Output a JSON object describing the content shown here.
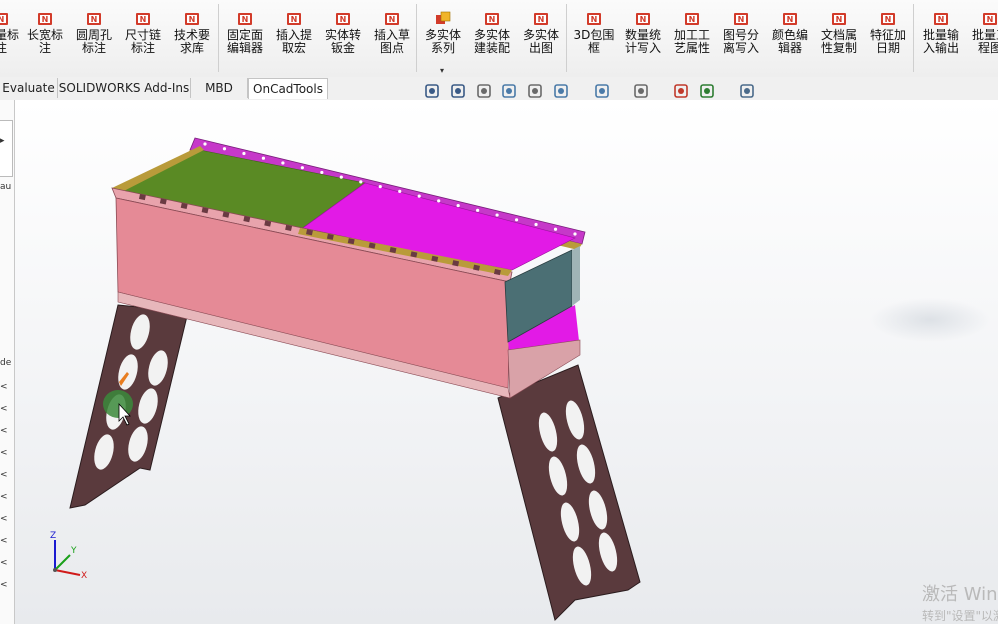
{
  "ribbon": {
    "buttons": [
      {
        "label": "批量标\n注",
        "icon": "annotation-icon"
      },
      {
        "label": "长宽标\n注",
        "icon": "dimension-icon"
      },
      {
        "label": "圆周孔\n标注",
        "icon": "hole-note-icon"
      },
      {
        "label": "尺寸链\n标注",
        "icon": "dim-chain-icon"
      },
      {
        "label": "技术要\n求库",
        "icon": "tech-req-icon"
      },
      {
        "label": "固定面\n编辑器",
        "icon": "fixed-face-icon"
      },
      {
        "label": "插入提\n取宏",
        "icon": "insert-macro-icon"
      },
      {
        "label": "实体转\n钣金",
        "icon": "sheetmetal-icon"
      },
      {
        "label": "插入草\n图点",
        "icon": "sketch-point-icon"
      },
      {
        "label": "多实体\n系列",
        "icon": "multibody-series-icon",
        "dropdown": "▾"
      },
      {
        "label": "多实体\n建装配",
        "icon": "multibody-assembly-icon"
      },
      {
        "label": "多实体\n出图",
        "icon": "multibody-drawing-icon"
      },
      {
        "label": "3D包围\n框",
        "icon": "bounding-box-icon"
      },
      {
        "label": "数量统\n计写入",
        "icon": "quantity-icon"
      },
      {
        "label": "加工工\n艺属性",
        "icon": "process-icon"
      },
      {
        "label": "图号分\n离写入",
        "icon": "drawing-number-icon"
      },
      {
        "label": "颜色编\n辑器",
        "icon": "color-editor-icon"
      },
      {
        "label": "文档属\n性复制",
        "icon": "doc-props-icon"
      },
      {
        "label": "特征加\n日期",
        "icon": "feature-date-icon"
      },
      {
        "label": "批量输\n入输出",
        "icon": "batch-io-icon"
      },
      {
        "label": "批量工\n程图",
        "icon": "batch-drawing-icon"
      }
    ]
  },
  "tabs": [
    {
      "label": "Evaluate"
    },
    {
      "label": "SOLIDWORKS Add-Ins"
    },
    {
      "label": "MBD"
    },
    {
      "label": "OnCadTools",
      "active": true
    }
  ],
  "hud": {
    "icons": [
      "zoom-to-fit-icon",
      "zoom-area-icon",
      "previous-view-icon",
      "section-view-icon",
      "dynamic-annotation-icon",
      "view-orientation-icon",
      "display-style-icon",
      "hide-show-icon",
      "edit-appearance-icon",
      "apply-scene-icon",
      "view-settings-icon"
    ]
  },
  "left_panel": {
    "fragments": [
      "au",
      "de",
      "<",
      "<",
      "<",
      "<",
      "<",
      "<",
      "<",
      "<",
      "<",
      "<"
    ]
  },
  "triad": {
    "x": "X",
    "y": "Y",
    "z": "Z"
  },
  "watermark": {
    "line1": "激活 Windows",
    "line2": "转到\"设置\"以激活"
  },
  "colors": {
    "front_panel": "#e58a96",
    "top_green": "#5a8a24",
    "top_magenta": "#e21ae6",
    "rail": "#c638c9",
    "legs": "#5a3a3d",
    "end_cap": "#4b6f74"
  }
}
